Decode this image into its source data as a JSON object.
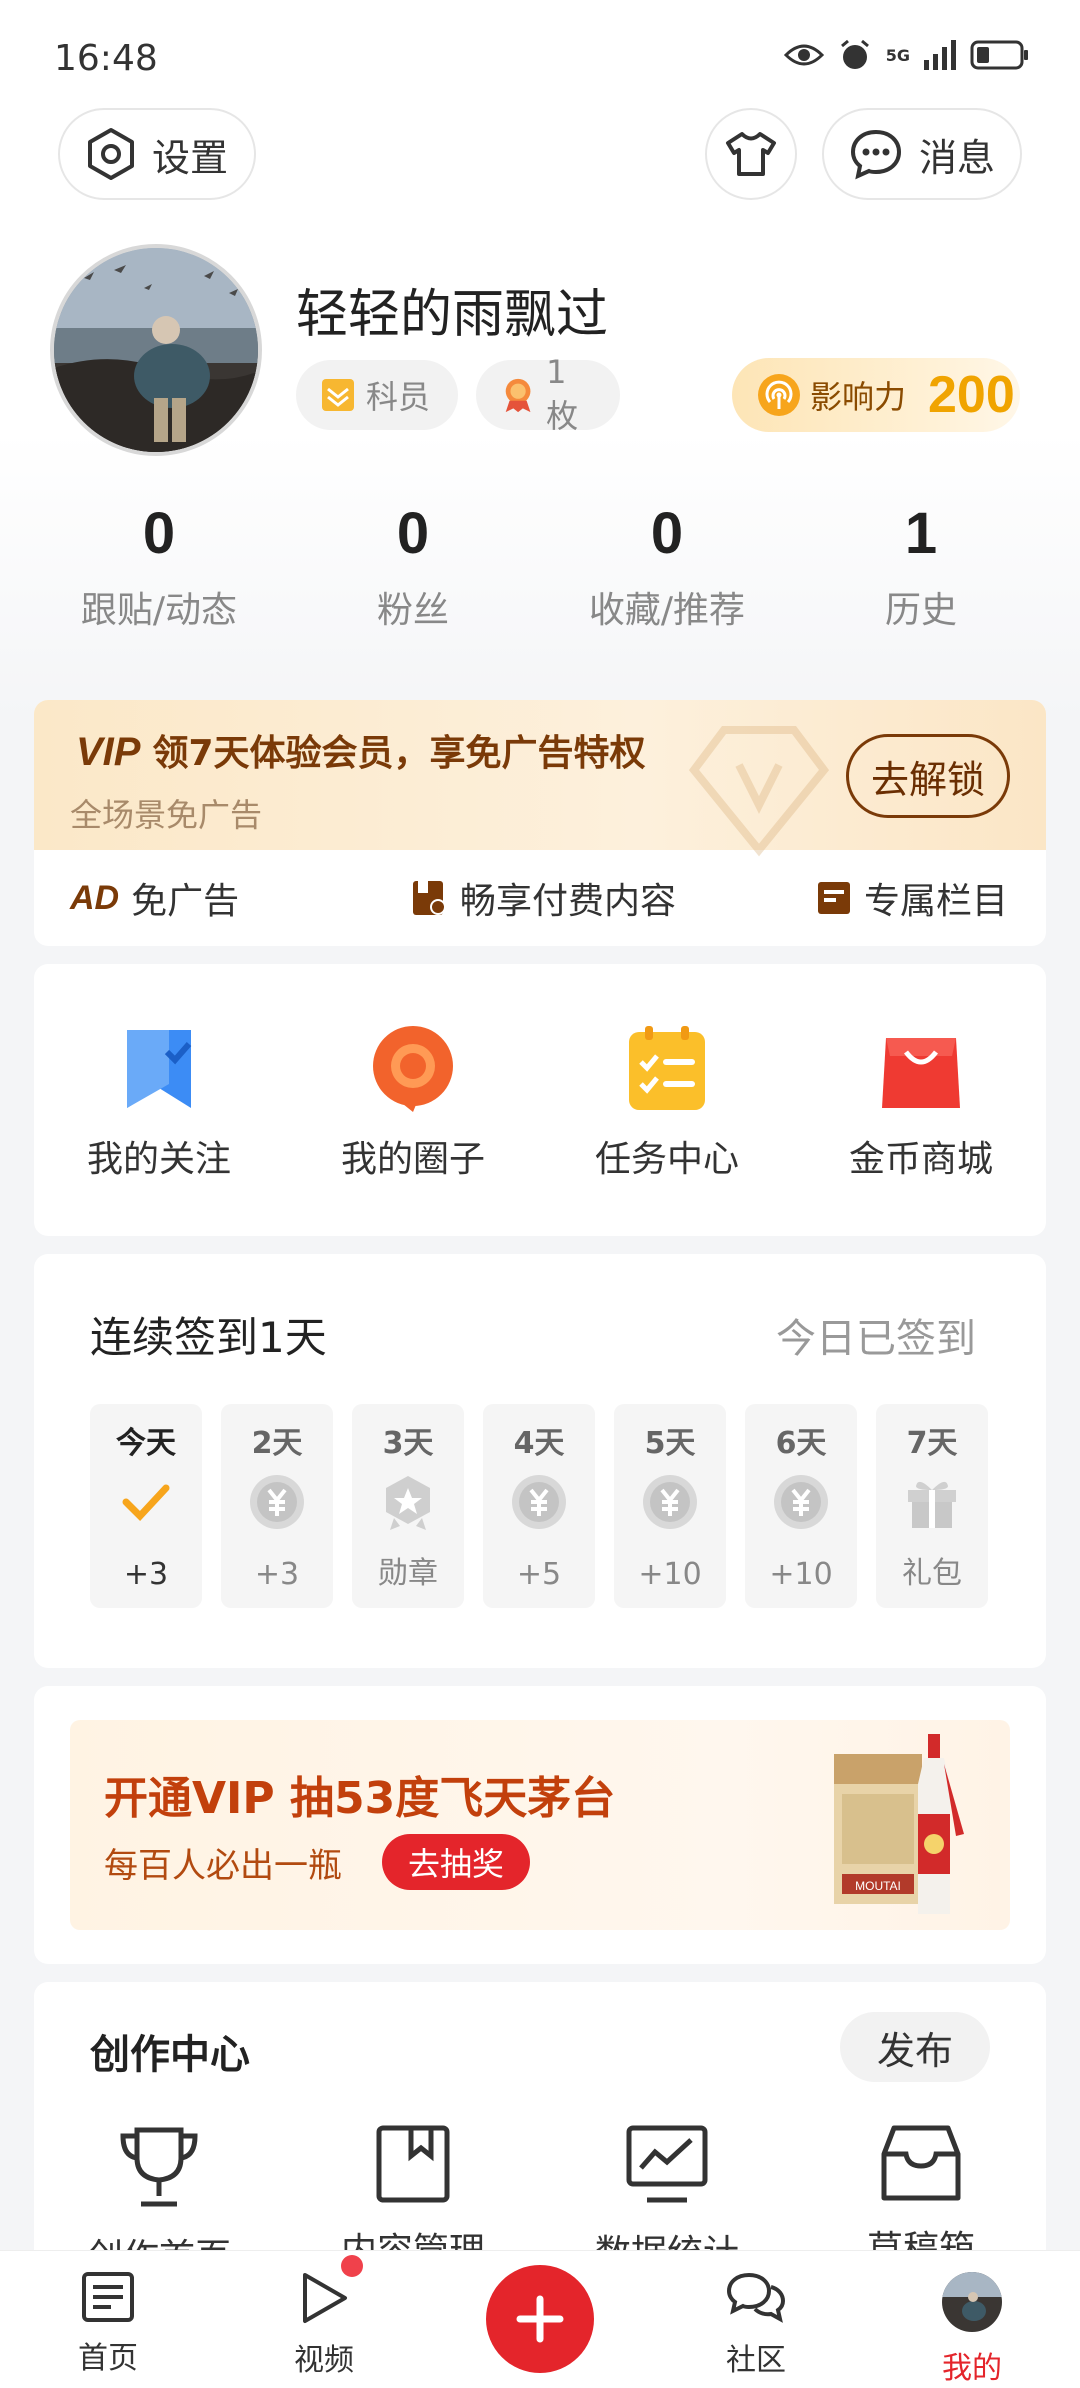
{
  "status_bar": {
    "time": "16:48",
    "network": "5G",
    "icons": [
      "eye-icon",
      "alarm-icon",
      "signal-icon",
      "battery-icon"
    ]
  },
  "header": {
    "settings_label": "设置",
    "messages_label": "消息",
    "icons": [
      "settings-icon",
      "shirt-icon",
      "message-icon"
    ]
  },
  "profile": {
    "username": "轻轻的雨飘过",
    "rank_label": "科员",
    "medal_label": "1枚",
    "influence_label": "影响力",
    "influence_value": "200"
  },
  "stats": [
    {
      "value": "0",
      "label": "跟贴/动态"
    },
    {
      "value": "0",
      "label": "粉丝"
    },
    {
      "value": "0",
      "label": "收藏/推荐"
    },
    {
      "value": "1",
      "label": "历史"
    }
  ],
  "vip": {
    "mark": "VIP",
    "title": "领7天体验会员，享免广告特权",
    "subtitle": "全场景免广告",
    "unlock_label": "去解锁",
    "perks": [
      {
        "icon": "ad-icon",
        "badge": "AD",
        "label": "免广告"
      },
      {
        "icon": "paid-content-icon",
        "label": "畅享付费内容"
      },
      {
        "icon": "column-icon",
        "label": "专属栏目"
      }
    ]
  },
  "shortcuts": [
    {
      "icon": "bookmark-icon",
      "label": "我的关注",
      "color": "#3c8cf5"
    },
    {
      "icon": "circle-chat-icon",
      "label": "我的圈子",
      "color": "#f2632c"
    },
    {
      "icon": "task-list-icon",
      "label": "任务中心",
      "color": "#fbbf2a"
    },
    {
      "icon": "shopping-bag-icon",
      "label": "金币商城",
      "color": "#ef3a32"
    }
  ],
  "checkin": {
    "title": "连续签到1天",
    "status": "今日已签到",
    "days": [
      {
        "day": "今天",
        "reward": "+3",
        "icon": "checkmark-icon"
      },
      {
        "day": "2天",
        "reward": "+3",
        "icon": "coin-icon"
      },
      {
        "day": "3天",
        "reward": "勋章",
        "icon": "medal-icon"
      },
      {
        "day": "4天",
        "reward": "+5",
        "icon": "coin-icon"
      },
      {
        "day": "5天",
        "reward": "+10",
        "icon": "coin-icon"
      },
      {
        "day": "6天",
        "reward": "+10",
        "icon": "coin-icon"
      },
      {
        "day": "7天",
        "reward": "礼包",
        "icon": "gift-icon"
      }
    ]
  },
  "promo": {
    "title": "开通VIP 抽53度飞天茅台",
    "subtitle": "每百人必出一瓶",
    "button_label": "去抽奖",
    "product_label": "MOUTAI"
  },
  "creation": {
    "title": "创作中心",
    "publish_label": "发布",
    "items": [
      {
        "icon": "trophy-icon",
        "label": "创作首页"
      },
      {
        "icon": "content-manage-icon",
        "label": "内容管理"
      },
      {
        "icon": "data-chart-icon",
        "label": "数据统计"
      },
      {
        "icon": "draft-box-icon",
        "label": "草稿箱"
      }
    ]
  },
  "bottom_nav": [
    {
      "icon": "news-icon",
      "label": "首页"
    },
    {
      "icon": "video-play-icon",
      "label": "视频"
    },
    {
      "icon": "plus-icon",
      "label": ""
    },
    {
      "icon": "community-icon",
      "label": "社区"
    },
    {
      "icon": "avatar-icon",
      "label": "我的"
    }
  ],
  "colors": {
    "brand_red": "#e4252b",
    "vip_brown": "#7a3a08",
    "influence_gold": "#f0a400"
  }
}
